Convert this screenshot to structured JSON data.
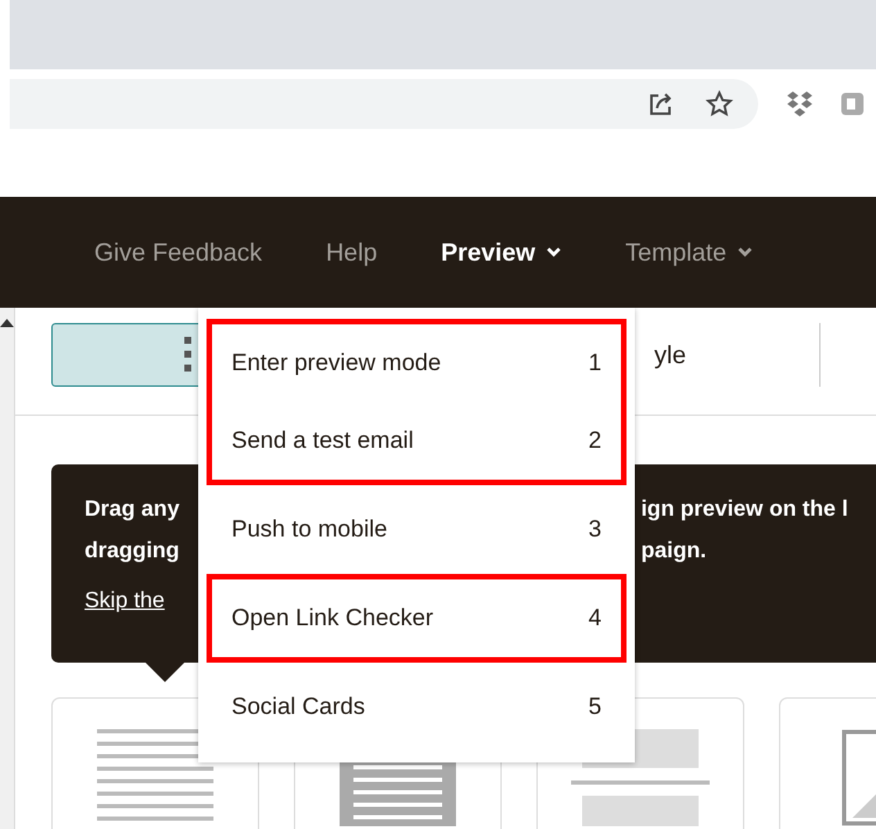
{
  "nav": {
    "items": [
      {
        "label": "Give Feedback",
        "selected": false,
        "has_caret": false
      },
      {
        "label": "Help",
        "selected": false,
        "has_caret": false
      },
      {
        "label": "Preview",
        "selected": true,
        "has_caret": true
      },
      {
        "label": "Template",
        "selected": false,
        "has_caret": true
      }
    ]
  },
  "tab_row": {
    "visible_label": "yle"
  },
  "tooltip": {
    "left_lines": [
      "Drag any",
      "dragging"
    ],
    "right_lines": [
      "ign preview on the l",
      "paign."
    ],
    "link": "Skip the"
  },
  "menu": {
    "sections": [
      {
        "highlighted": true,
        "items": [
          {
            "label": "Enter preview mode",
            "shortcut": "1"
          },
          {
            "label": "Send a test email",
            "shortcut": "2"
          }
        ]
      },
      {
        "highlighted": false,
        "items": [
          {
            "label": "Push to mobile",
            "shortcut": "3"
          }
        ]
      },
      {
        "highlighted": true,
        "items": [
          {
            "label": "Open Link Checker",
            "shortcut": "4"
          }
        ]
      },
      {
        "highlighted": false,
        "items": [
          {
            "label": "Social Cards",
            "shortcut": "5"
          }
        ]
      }
    ]
  },
  "cards": [
    {
      "kind": "text"
    },
    {
      "kind": "column"
    },
    {
      "kind": "layout"
    },
    {
      "kind": "image"
    }
  ]
}
